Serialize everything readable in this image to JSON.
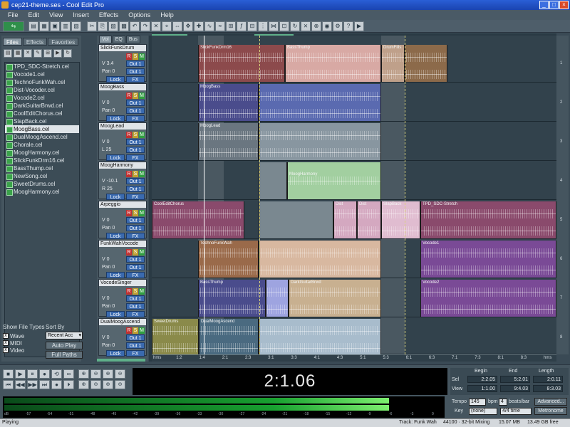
{
  "window": {
    "title": "cep21-theme.ses - Cool Edit Pro"
  },
  "menu": [
    "File",
    "Edit",
    "View",
    "Insert",
    "Effects",
    "Options",
    "Help"
  ],
  "file_panel": {
    "tabs": [
      "Files",
      "Effects",
      "Favorites"
    ],
    "files": [
      "TPD_SDC-Stretch.cel",
      "Vocode1.cel",
      "TechnoFunkWah.cel",
      "Dist-Vocoder.cel",
      "Vocode2.cel",
      "DarkGuitarBrwd.cel",
      "CoolEditChorus.cel",
      "SlapBack.cel",
      "MoogBass.cel",
      "DualMoogAscend.cel",
      "Chorale.cel",
      "MoogHarmony.cel",
      "SlickFunkDrm16.cel",
      "BassThump.cel",
      "NewSong.cel",
      "SweetDrums.cel",
      "MoogHarmony.cel"
    ],
    "selected_index": 8,
    "show_label": "Show File Types",
    "sort_label": "Sort By",
    "types": [
      "Wave",
      "MIDI",
      "Video"
    ],
    "sort_value": "Recent Acc",
    "auto_play": "Auto Play",
    "full_paths": "Full Paths"
  },
  "header_tabs": [
    "Vol",
    "EQ",
    "Bus"
  ],
  "tracks": [
    {
      "name": "SlickFunkDrum",
      "vol": "V 3.4",
      "pan": "Pan 0",
      "out": "Out 1",
      "a": "Lock",
      "b": "FX"
    },
    {
      "name": "MoogBass",
      "vol": "V 0",
      "pan": "Pan 0",
      "out": "Out 1",
      "a": "Lock",
      "b": "FX"
    },
    {
      "name": "MoogLead",
      "vol": "V 0",
      "pan": "L 25",
      "out": "Out 1",
      "a": "Lock",
      "b": "FX"
    },
    {
      "name": "MoogHarmony",
      "vol": "V -10.1",
      "pan": "R 25",
      "out": "Out 1",
      "a": "Lock",
      "b": "FX"
    },
    {
      "name": "Arpeggio",
      "vol": "V 0",
      "pan": "Pan 0",
      "out": "Out 1",
      "a": "Lock",
      "b": "FX"
    },
    {
      "name": "FunkWahVocode",
      "vol": "V 0",
      "pan": "Pan 0",
      "out": "Out 1",
      "a": "Lock",
      "b": "FX"
    },
    {
      "name": "VocodeSinger",
      "vol": "V 0",
      "pan": "Pan 0",
      "out": "Out 1",
      "a": "Lock",
      "b": "FX"
    },
    {
      "name": "DualMoogAscend",
      "vol": "V 0",
      "pan": "Pan 0",
      "out": "Out 1",
      "a": "Lock",
      "b": "FX"
    }
  ],
  "clip_names": {
    "c0a": "SlickFunkDrm16",
    "c0b": "BassThump",
    "c0c": "DrumFills",
    "c1a": "MoogBass",
    "c2a": "MoogLead",
    "c3a": "MoogHarmony",
    "c4a": "CoolEditChorus",
    "c4b": "Dist",
    "c4c": "Dist",
    "c4d": "SlapBack",
    "c4e": "TPD_SDC-Stretch",
    "c5a": "TechnoFunkWah",
    "c5b": "Vocode1",
    "c6a": "BassThump",
    "c6b": "DarkGuitarBrwd",
    "c6c": "Vocode2",
    "c7a": "SweetDrums",
    "c7b": "DualMoogAscend"
  },
  "lane_numbers": [
    "1",
    "2",
    "3",
    "4",
    "5",
    "6",
    "7",
    "8"
  ],
  "timeline_ticks": [
    "hms",
    "1:2",
    "1:4",
    "2:1",
    "2:3",
    "3:1",
    "3:3",
    "4:1",
    "4:3",
    "5:1",
    "5:3",
    "6:1",
    "6:3",
    "7:1",
    "7:3",
    "8:1",
    "8:3",
    "hms"
  ],
  "transport": {
    "row1": [
      "■",
      "▶",
      "⏸",
      "●",
      "⟲",
      "∞"
    ],
    "row2": [
      "⏮",
      "◀◀",
      "▶▶",
      "⏭",
      "●",
      "⏵"
    ],
    "zoom1": [
      "⊕",
      "⊖",
      "⊕",
      "⊖"
    ],
    "zoom2": [
      "⊕",
      "⊖",
      "⊕",
      "⊖"
    ]
  },
  "time_display": "2:1.06",
  "selection": {
    "headers": [
      "Begin",
      "End",
      "Length"
    ],
    "sel_label": "Sel",
    "view_label": "View",
    "sel": [
      "2:2.05",
      "5:2.01",
      "2:0.11"
    ],
    "view": [
      "1:1.00",
      "9:4.03",
      "8:3.03"
    ]
  },
  "meter_scale": [
    "dB",
    "-57",
    "-54",
    "-51",
    "-48",
    "-45",
    "-42",
    "-39",
    "-36",
    "-33",
    "-30",
    "-27",
    "-24",
    "-21",
    "-18",
    "-15",
    "-12",
    "-9",
    "-6",
    "-3",
    "0"
  ],
  "tempo": {
    "tempo_label": "Tempo",
    "tempo_value": "145",
    "bpm_label": "bpm",
    "beats_value": "4",
    "beats_label": "beats/bar",
    "key_label": "Key",
    "key_value": "(none)",
    "meter_value": "4/4 time",
    "advanced": "Advanced...",
    "metronome": "Metronome"
  },
  "status": {
    "left": "Playing",
    "mid": "Track: Funk Wah",
    "rate": "44100 · 32-bit Mixing",
    "free": "15.07 MB",
    "disk": "13.49 GB free"
  }
}
